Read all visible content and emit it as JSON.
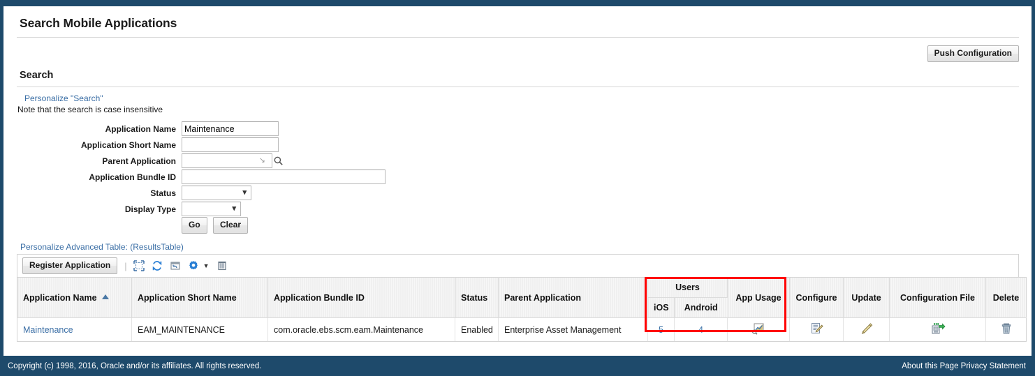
{
  "header": {
    "title": "Search Mobile Applications",
    "push_configuration_label": "Push Configuration"
  },
  "search": {
    "section_title": "Search",
    "personalize_link": "Personalize \"Search\"",
    "note": "Note that the search is case insensitive",
    "fields": [
      {
        "label": "Application Name",
        "value": "Maintenance",
        "type": "text"
      },
      {
        "label": "Application Short Name",
        "value": "",
        "type": "text"
      },
      {
        "label": "Parent Application",
        "value": "",
        "type": "lov"
      },
      {
        "label": "Application Bundle ID",
        "value": "",
        "type": "text"
      },
      {
        "label": "Status",
        "value": "",
        "type": "select"
      },
      {
        "label": "Display Type",
        "value": "",
        "type": "select"
      }
    ],
    "go_label": "Go",
    "clear_label": "Clear"
  },
  "results": {
    "personalize_table_link": "Personalize Advanced Table: (ResultsTable)",
    "register_application_label": "Register Application",
    "toolbar_icons": [
      "expand-all-icon",
      "refresh-icon",
      "export-icon",
      "gear-icon",
      "detach-icon"
    ],
    "columns": {
      "application_name": "Application Name",
      "application_short_name": "Application Short Name",
      "application_bundle_id": "Application Bundle ID",
      "status": "Status",
      "parent_application": "Parent Application",
      "users_group": "Users",
      "users_ios": "iOS",
      "users_android": "Android",
      "app_usage": "App Usage",
      "configure": "Configure",
      "update": "Update",
      "configuration_file": "Configuration File",
      "delete": "Delete"
    },
    "sort": {
      "column": "Application Name",
      "direction": "ascending"
    },
    "rows": [
      {
        "application_name": "Maintenance",
        "application_short_name": "EAM_MAINTENANCE",
        "application_bundle_id": "com.oracle.ebs.scm.eam.Maintenance",
        "status": "Enabled",
        "parent_application": "Enterprise Asset Management",
        "users_ios": "5",
        "users_android": "4",
        "app_usage_icon": "chart-usage-icon",
        "configure_icon": "document-edit-icon",
        "update_icon": "pencil-icon",
        "configuration_file_icon": "export-file-icon",
        "delete_icon": "trash-icon"
      }
    ]
  },
  "footer": {
    "copyright": "Copyright (c) 1998, 2016, Oracle and/or its affiliates. All rights reserved.",
    "about_link": "About this Page",
    "privacy_link": "Privacy Statement"
  },
  "colors": {
    "chrome_navy": "#1e4a6b",
    "link_blue": "#3a6ea5",
    "highlight_red": "#ff0000"
  }
}
